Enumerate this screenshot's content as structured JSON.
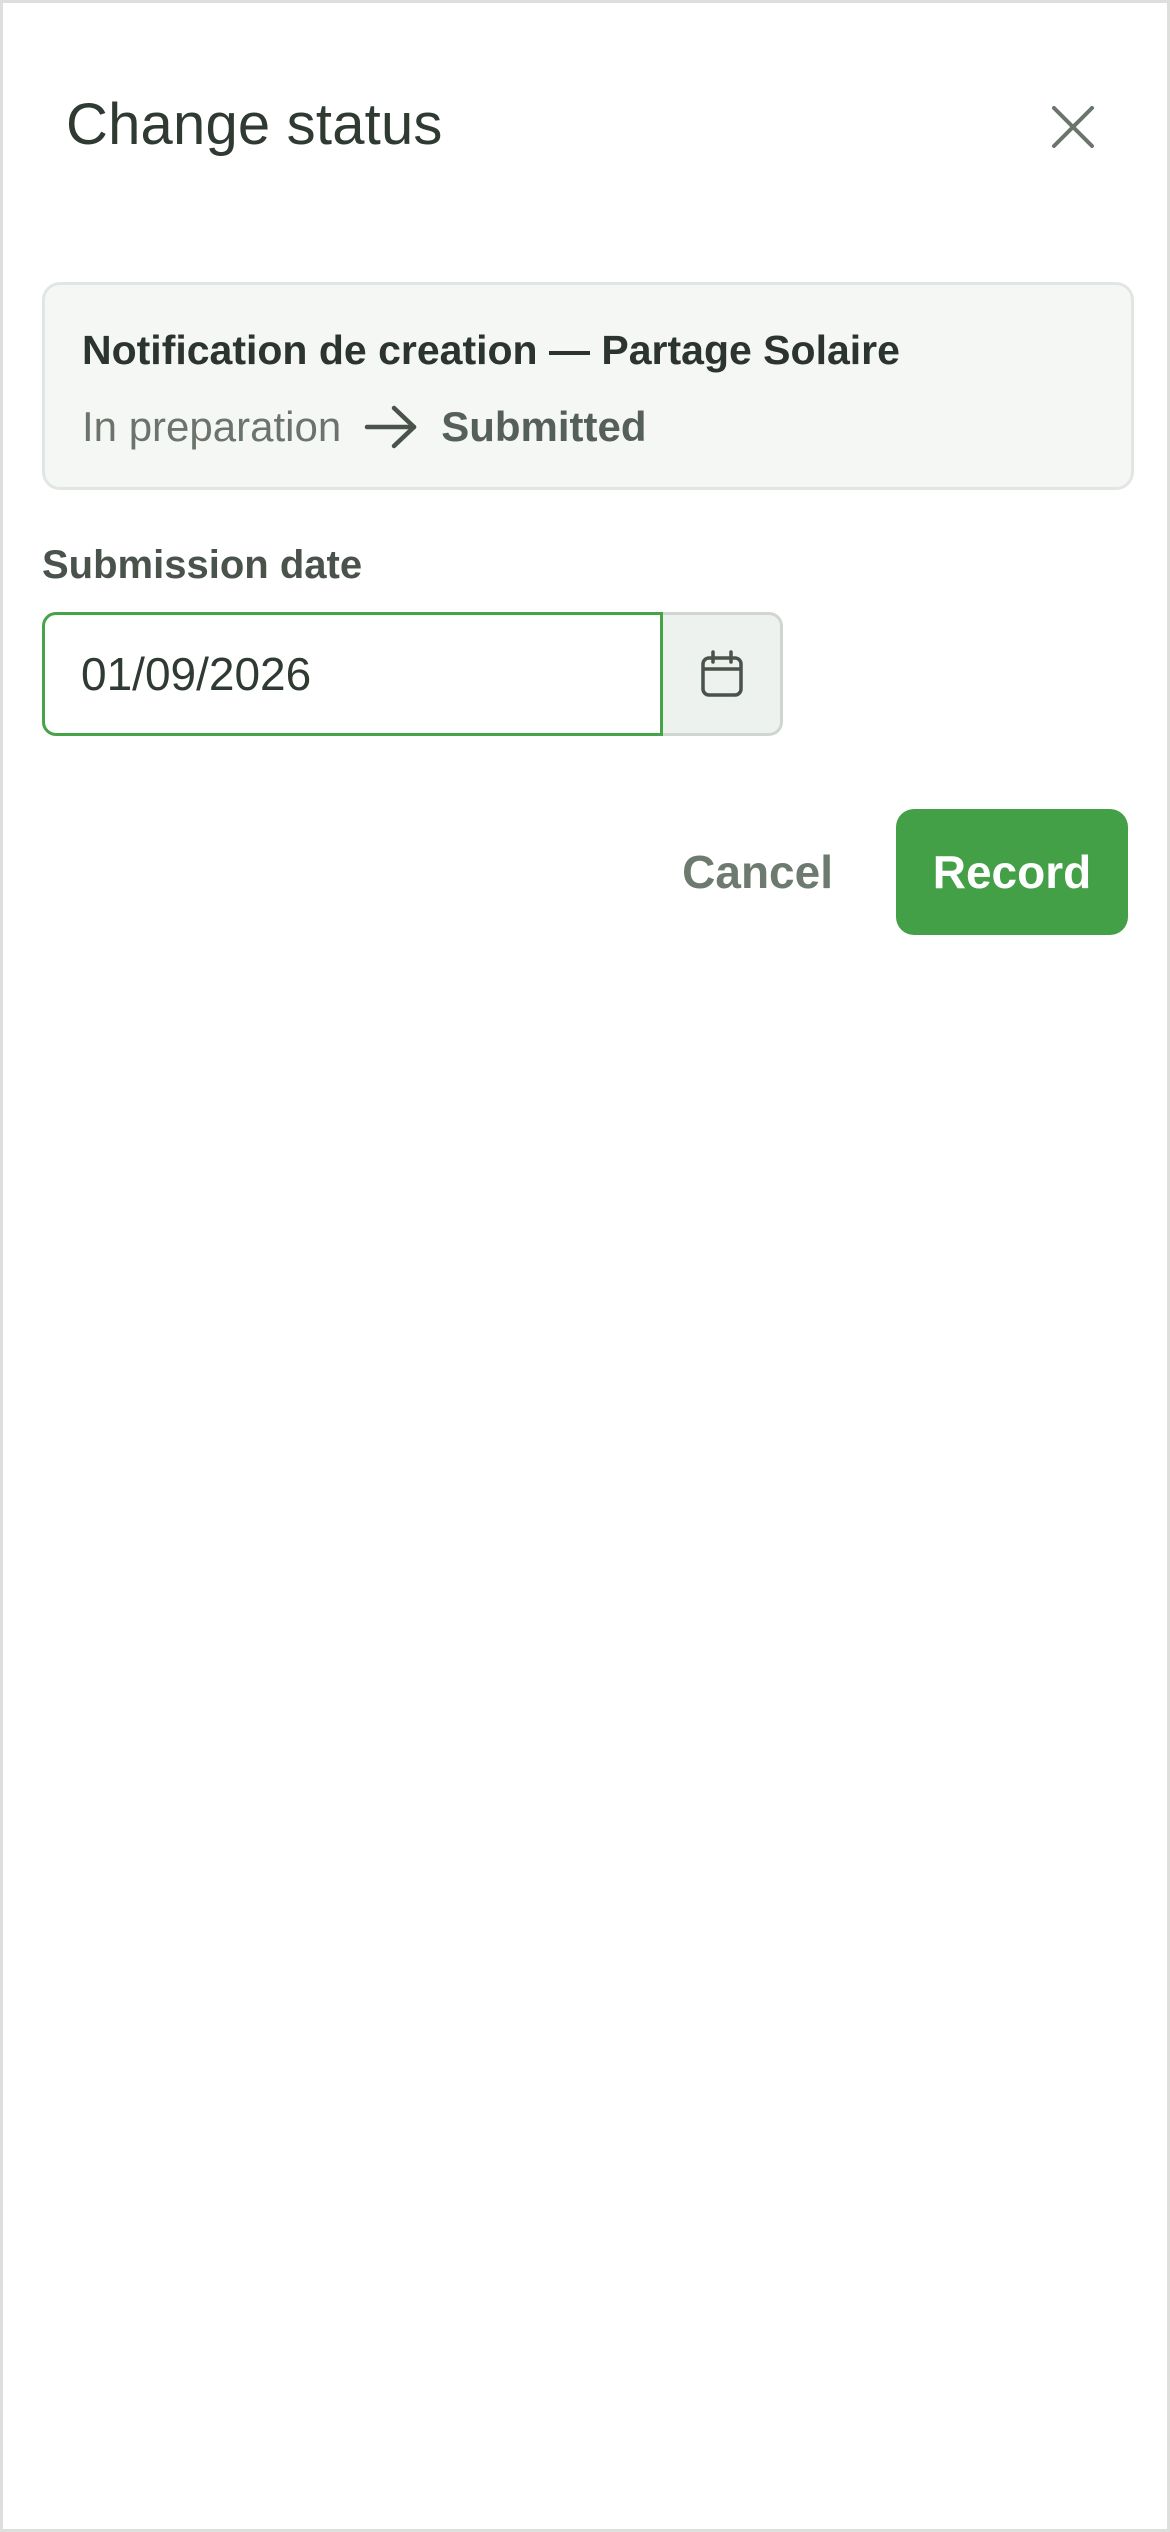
{
  "dialog": {
    "title": "Change status",
    "close_icon": "close-icon"
  },
  "summary": {
    "item_title": "Notification de creation — Partage Solaire",
    "from_status": "In preparation",
    "arrow_icon": "arrow-right-icon",
    "to_status": "Submitted"
  },
  "form": {
    "date_label": "Submission date",
    "date_value": "01/09/2026",
    "calendar_icon": "calendar-icon"
  },
  "actions": {
    "cancel_label": "Cancel",
    "record_label": "Record"
  },
  "colors": {
    "accent": "#43a047",
    "text": "#2f3a33",
    "muted": "#6d7a70",
    "card_bg": "#f5f7f5"
  }
}
